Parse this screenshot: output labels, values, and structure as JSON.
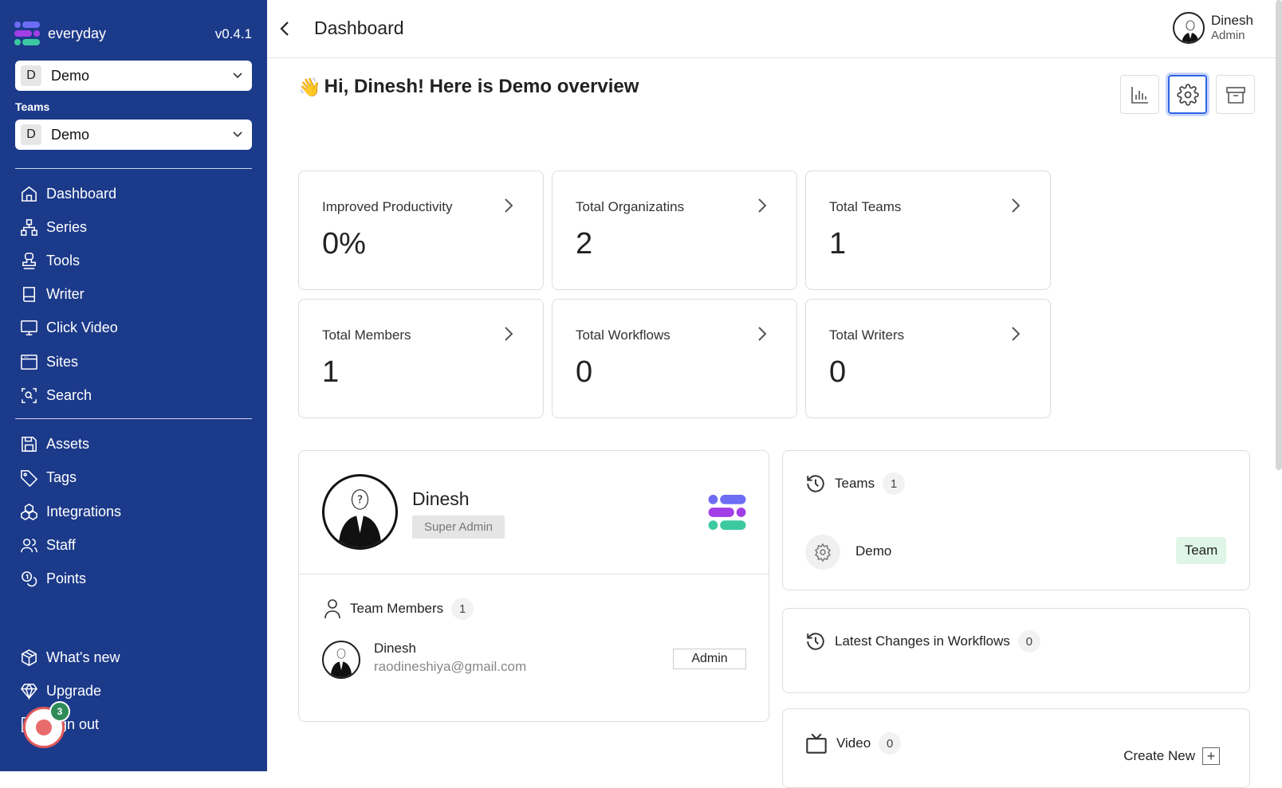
{
  "sidebar": {
    "logo_text": "everyday",
    "version": "v0.4.1",
    "org_select": {
      "badge": "D",
      "value": "Demo"
    },
    "teams_label": "Teams",
    "team_select": {
      "badge": "D",
      "value": "Demo"
    },
    "nav_main": [
      {
        "label": "Dashboard",
        "icon": "home-icon"
      },
      {
        "label": "Series",
        "icon": "sitemap-icon"
      },
      {
        "label": "Tools",
        "icon": "stamp-icon"
      },
      {
        "label": "Writer",
        "icon": "book-icon"
      },
      {
        "label": "Click Video",
        "icon": "monitor-icon"
      },
      {
        "label": "Sites",
        "icon": "browser-icon"
      },
      {
        "label": "Search",
        "icon": "scan-search-icon"
      }
    ],
    "nav_secondary": [
      {
        "label": "Assets",
        "icon": "save-icon"
      },
      {
        "label": "Tags",
        "icon": "tag-icon"
      },
      {
        "label": "Integrations",
        "icon": "boxes-icon"
      },
      {
        "label": "Staff",
        "icon": "users-icon"
      },
      {
        "label": "Points",
        "icon": "coins-icon"
      }
    ],
    "nav_bottom": [
      {
        "label": "What's new",
        "icon": "package-icon"
      },
      {
        "label": "Upgrade",
        "icon": "gem-icon"
      },
      {
        "label": "Sign out",
        "icon": "logout-icon"
      }
    ],
    "record_count": "3"
  },
  "header": {
    "title": "Dashboard",
    "user_name": "Dinesh",
    "user_role": "Admin"
  },
  "greeting": {
    "emoji": "👋",
    "text": "Hi, Dinesh! Here is Demo overview"
  },
  "toolbar": [
    "bar-chart-icon",
    "settings-icon",
    "archive-icon"
  ],
  "stats": [
    {
      "label": "Improved Productivity",
      "value": "0%"
    },
    {
      "label": "Total Organizatins",
      "value": "2"
    },
    {
      "label": "Total Teams",
      "value": "1"
    },
    {
      "label": "Total Members",
      "value": "1"
    },
    {
      "label": "Total Workflows",
      "value": "0"
    },
    {
      "label": "Total Writers",
      "value": "0"
    }
  ],
  "profile": {
    "name": "Dinesh",
    "role": "Super Admin",
    "team_members_label": "Team Members",
    "team_members_count": "1",
    "member": {
      "name": "Dinesh",
      "email": "raodineshiya@gmail.com",
      "role": "Admin"
    }
  },
  "teams_panel": {
    "title": "Teams",
    "count": "1",
    "team_name": "Demo",
    "team_tag": "Team"
  },
  "workflows_panel": {
    "title": "Latest Changes in Workflows",
    "count": "0"
  },
  "video_panel": {
    "title": "Video",
    "count": "0",
    "create_label": "Create New"
  },
  "colors": {
    "sidebar_bg": "#1c3a8a",
    "accent": "#2f63e6",
    "tag_bg": "#dff5e6",
    "record_badge": "#2e8b57"
  }
}
